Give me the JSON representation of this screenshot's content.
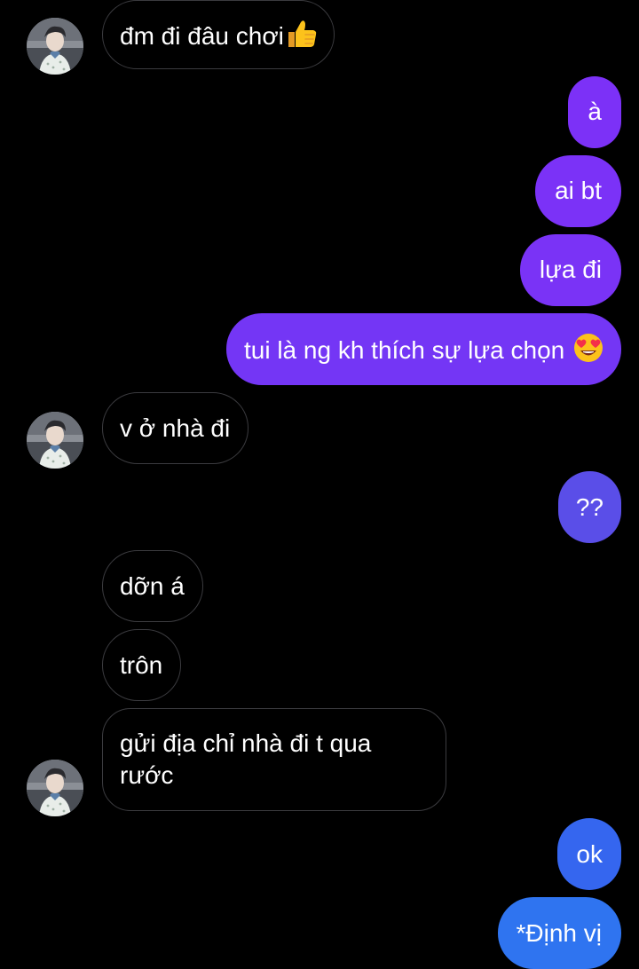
{
  "conversation": {
    "contact": {
      "avatar_icon": "profile-photo-avatar"
    },
    "colors": {
      "background": "#000000",
      "incoming_bubble_border": "#3b3b3f",
      "outgoing_purple": "#7a33f6",
      "outgoing_indigo": "#5a4ee8",
      "outgoing_blue": "#2f74f0"
    },
    "messages": [
      {
        "id": "m1",
        "direction": "incoming",
        "text": "đm đi đâu chơi",
        "emoji": "thumbs-up-icon"
      },
      {
        "id": "m2",
        "direction": "outgoing",
        "text": "à"
      },
      {
        "id": "m3",
        "direction": "outgoing",
        "text": "ai bt"
      },
      {
        "id": "m4",
        "direction": "outgoing",
        "text": "lựa đi"
      },
      {
        "id": "m5",
        "direction": "outgoing",
        "text": "tui là ng kh thích sự lựa chọn",
        "emoji": "heart-eyes-emoji-icon"
      },
      {
        "id": "m6",
        "direction": "incoming",
        "text": "v ở nhà đi"
      },
      {
        "id": "m7",
        "direction": "outgoing",
        "text": "??"
      },
      {
        "id": "m8",
        "direction": "incoming",
        "text": "dỡn á"
      },
      {
        "id": "m9",
        "direction": "incoming",
        "text": "trôn"
      },
      {
        "id": "m10",
        "direction": "incoming",
        "text": "gửi địa chỉ nhà đi t qua rước"
      },
      {
        "id": "m11",
        "direction": "outgoing",
        "text": "ok"
      },
      {
        "id": "m12",
        "direction": "outgoing",
        "text": "*Định vị"
      }
    ]
  }
}
